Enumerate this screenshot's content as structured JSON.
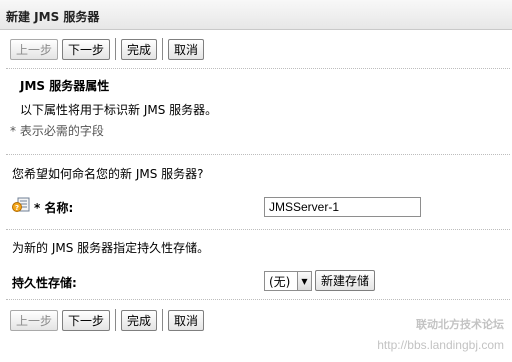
{
  "window": {
    "title": "新建 JMS 服务器"
  },
  "buttons": {
    "back": "上一步",
    "next": "下一步",
    "finish": "完成",
    "cancel": "取消"
  },
  "section": {
    "heading": "JMS 服务器属性",
    "description": "以下属性将用于标识新 JMS 服务器。",
    "required_note": "* 表示必需的字段"
  },
  "name_section": {
    "question": "您希望如何命名您的新 JMS 服务器?",
    "field_label": "* 名称:",
    "field_value": "JMSServer-1",
    "icon": "help-icon"
  },
  "store_section": {
    "instruction": "为新的 JMS 服务器指定持久性存储。",
    "field_label": "持久性存储:",
    "selected": "(无)",
    "new_store_button": "新建存储"
  },
  "watermark": {
    "line1": "联动北方技术论坛",
    "line2": "http://bbs.landingbj.com"
  }
}
